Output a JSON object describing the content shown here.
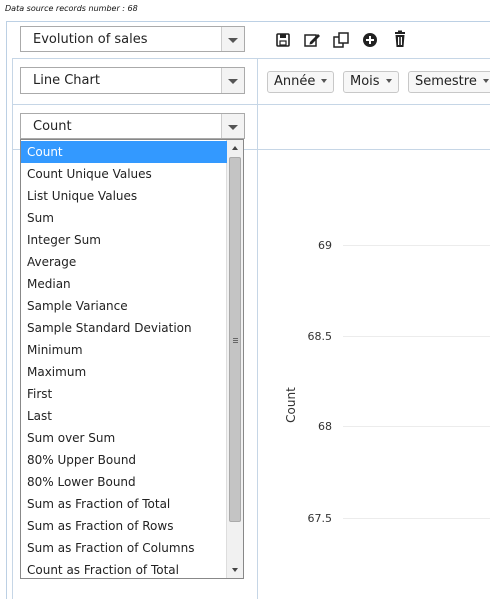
{
  "header": {
    "records_label": "Data source records number : 68"
  },
  "chart_selector": {
    "value": "Evolution of sales"
  },
  "toolbar": {
    "icons": [
      "save-icon",
      "edit-icon",
      "copy-icon",
      "add-icon",
      "delete-icon"
    ]
  },
  "renderer": {
    "value": "Line Chart"
  },
  "aggregator": {
    "value": "Count"
  },
  "attributes": [
    {
      "label": "Année"
    },
    {
      "label": "Mois"
    },
    {
      "label": "Semestre"
    }
  ],
  "aggregator_options": [
    "Count",
    "Count Unique Values",
    "List Unique Values",
    "Sum",
    "Integer Sum",
    "Average",
    "Median",
    "Sample Variance",
    "Sample Standard Deviation",
    "Minimum",
    "Maximum",
    "First",
    "Last",
    "Sum over Sum",
    "80% Upper Bound",
    "80% Lower Bound",
    "Sum as Fraction of Total",
    "Sum as Fraction of Rows",
    "Sum as Fraction of Columns",
    "Count as Fraction of Total"
  ],
  "selected_option": "Count",
  "chart_data": {
    "type": "line",
    "ylabel": "Count",
    "yticks": [
      "69",
      "68.5",
      "68",
      "67.5"
    ]
  }
}
